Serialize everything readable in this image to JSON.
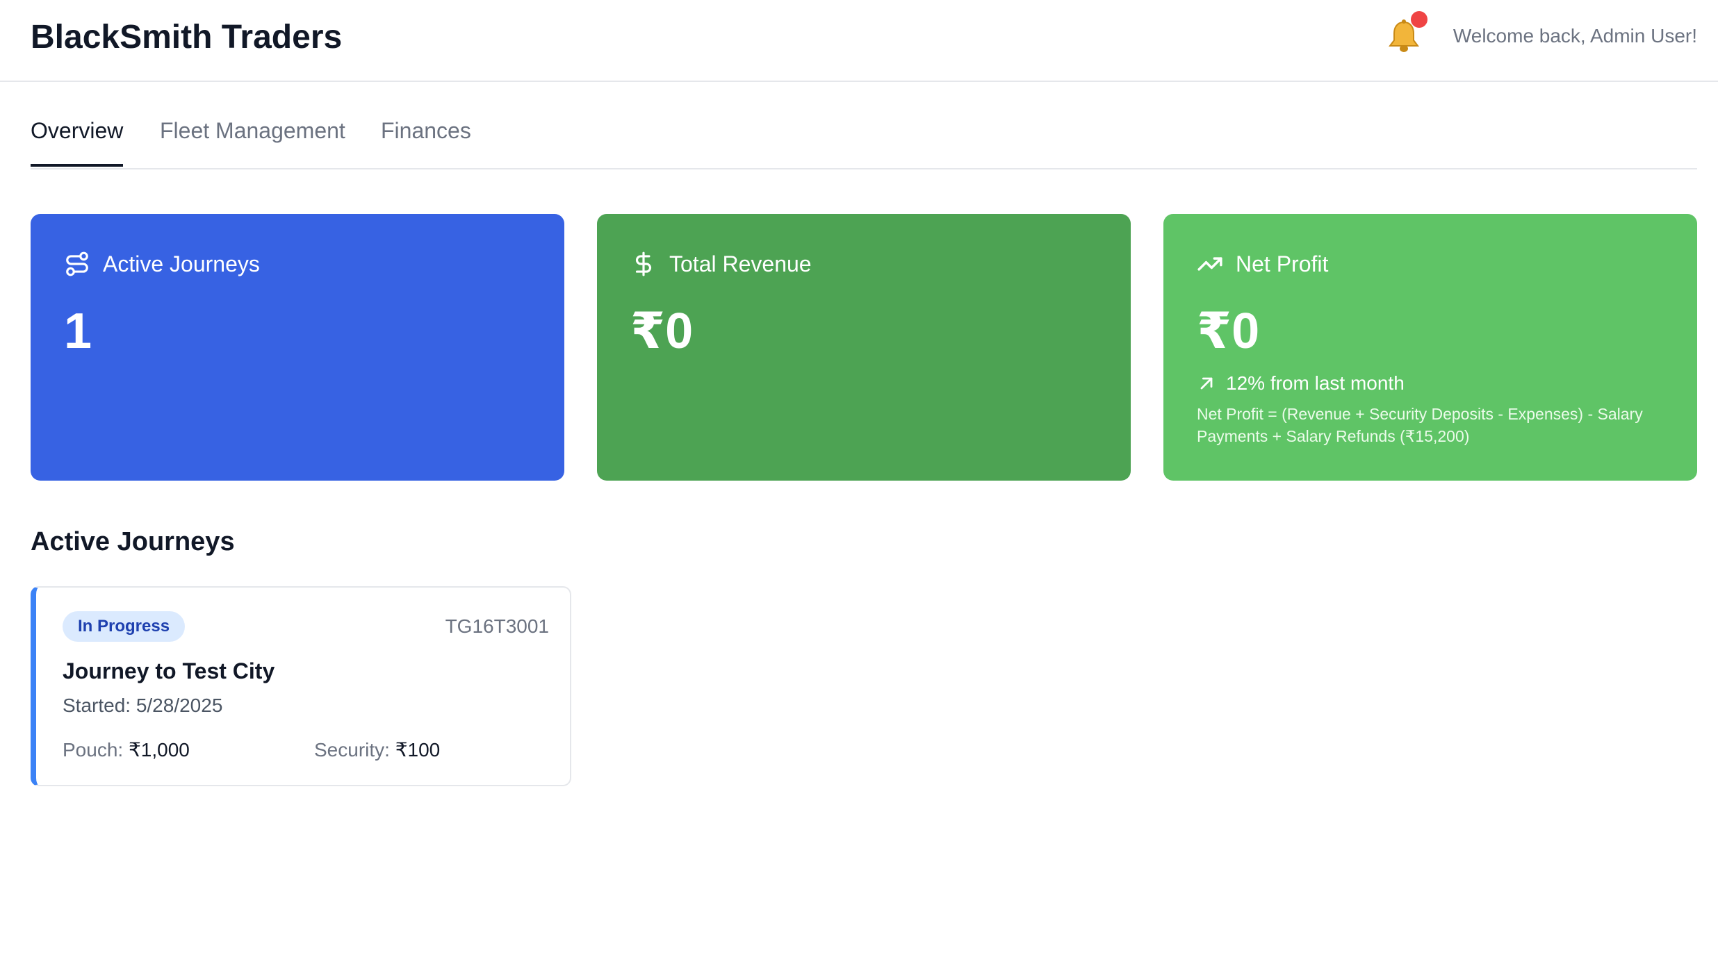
{
  "header": {
    "app_title": "BlackSmith Traders",
    "welcome": "Welcome back, Admin User!",
    "notification_icon": "bell-icon"
  },
  "tabs": [
    {
      "label": "Overview",
      "active": true
    },
    {
      "label": "Fleet Management",
      "active": false
    },
    {
      "label": "Finances",
      "active": false
    }
  ],
  "stats": {
    "active_journeys": {
      "title": "Active Journeys",
      "value": "1",
      "icon": "route-icon",
      "color": "#3762e3"
    },
    "total_revenue": {
      "title": "Total Revenue",
      "value": "₹0",
      "icon": "dollar-icon",
      "color": "#4da353"
    },
    "net_profit": {
      "title": "Net Profit",
      "value": "₹0",
      "icon": "trending-up-icon",
      "color": "#5fc466",
      "trend": "12% from last month",
      "formula": "Net Profit = (Revenue + Security Deposits - Expenses) - Salary Payments + Salary Refunds (₹15,200)"
    }
  },
  "section": {
    "title": "Active Journeys"
  },
  "journeys": [
    {
      "status": "In Progress",
      "vehicle": "TG16T3001",
      "title": "Journey to Test City",
      "started": "Started: 5/28/2025",
      "pouch_label": "Pouch:",
      "pouch_value": "₹1,000",
      "security_label": "Security:",
      "security_value": "₹100"
    }
  ]
}
